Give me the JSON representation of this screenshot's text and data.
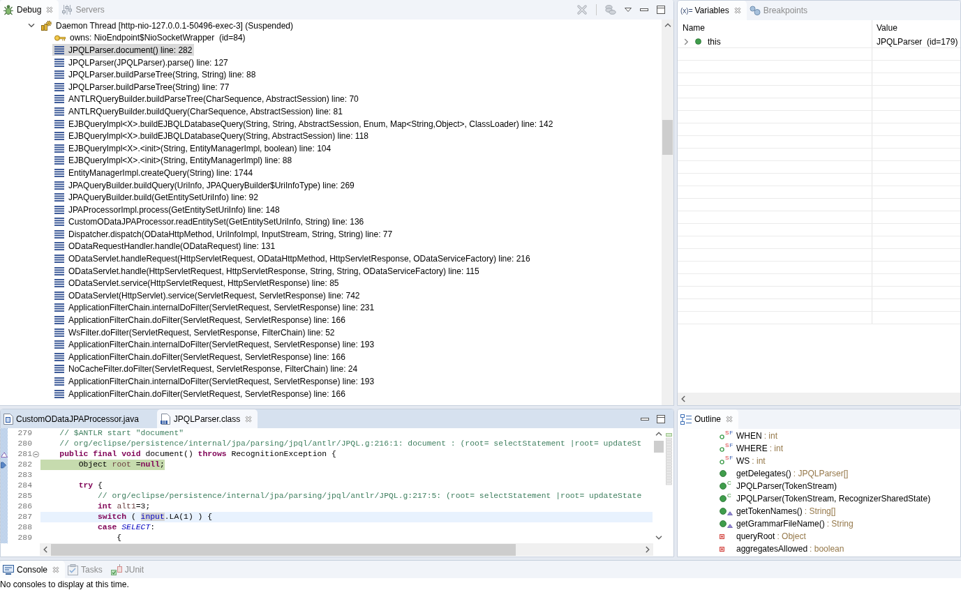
{
  "debug_view": {
    "tabs": [
      {
        "kind": "debug",
        "label": "Debug",
        "selected": true
      },
      {
        "kind": "servers",
        "label": "Servers",
        "selected": false
      }
    ],
    "thread": {
      "label": "Daemon Thread [http-nio-127.0.0.1-50496-exec-3] (Suspended)",
      "expanded": true,
      "monitor": "owns: NioEndpoint$NioSocketWrapper  (id=84)",
      "frames": [
        {
          "label": "JPQLParser.document() line: 282",
          "selected": true
        },
        {
          "label": "JPQLParser(JPQLParser).parse() line: 127",
          "selected": false
        },
        {
          "label": "JPQLParser.buildParseTree(String, String) line: 88",
          "selected": false
        },
        {
          "label": "JPQLParser.buildParseTree(String) line: 77",
          "selected": false
        },
        {
          "label": "ANTLRQueryBuilder.buildParseTree(CharSequence, AbstractSession) line: 70",
          "selected": false
        },
        {
          "label": "ANTLRQueryBuilder.buildQuery(CharSequence, AbstractSession) line: 81",
          "selected": false
        },
        {
          "label": "EJBQueryImpl<X>.buildEJBQLDatabaseQuery(String, String, AbstractSession, Enum, Map<String,Object>, ClassLoader) line: 142",
          "selected": false
        },
        {
          "label": "EJBQueryImpl<X>.buildEJBQLDatabaseQuery(String, AbstractSession) line: 118",
          "selected": false
        },
        {
          "label": "EJBQueryImpl<X>.<init>(String, EntityManagerImpl, boolean) line: 104",
          "selected": false
        },
        {
          "label": "EJBQueryImpl<X>.<init>(String, EntityManagerImpl) line: 88",
          "selected": false
        },
        {
          "label": "EntityManagerImpl.createQuery(String) line: 1744",
          "selected": false
        },
        {
          "label": "JPAQueryBuilder.buildQuery(UriInfo, JPAQueryBuilder$UriInfoType) line: 269",
          "selected": false
        },
        {
          "label": "JPAQueryBuilder.build(GetEntitySetUriInfo) line: 92",
          "selected": false
        },
        {
          "label": "JPAProcessorImpl.process(GetEntitySetUriInfo) line: 148",
          "selected": false
        },
        {
          "label": "CustomODataJPAProcessor.readEntitySet(GetEntitySetUriInfo, String) line: 136",
          "selected": false
        },
        {
          "label": "Dispatcher.dispatch(ODataHttpMethod, UriInfoImpl, InputStream, String, String) line: 77",
          "selected": false
        },
        {
          "label": "ODataRequestHandler.handle(ODataRequest) line: 131",
          "selected": false
        },
        {
          "label": "ODataServlet.handleRequest(HttpServletRequest, ODataHttpMethod, HttpServletResponse, ODataServiceFactory) line: 216",
          "selected": false
        },
        {
          "label": "ODataServlet.handle(HttpServletRequest, HttpServletResponse, String, String, ODataServiceFactory) line: 115",
          "selected": false
        },
        {
          "label": "ODataServlet.service(HttpServletRequest, HttpServletResponse) line: 85",
          "selected": false
        },
        {
          "label": "ODataServlet(HttpServlet).service(ServletRequest, ServletResponse) line: 742",
          "selected": false
        },
        {
          "label": "ApplicationFilterChain.internalDoFilter(ServletRequest, ServletResponse) line: 231",
          "selected": false
        },
        {
          "label": "ApplicationFilterChain.doFilter(ServletRequest, ServletResponse) line: 166",
          "selected": false
        },
        {
          "label": "WsFilter.doFilter(ServletRequest, ServletResponse, FilterChain) line: 52",
          "selected": false
        },
        {
          "label": "ApplicationFilterChain.internalDoFilter(ServletRequest, ServletResponse) line: 193",
          "selected": false
        },
        {
          "label": "ApplicationFilterChain.doFilter(ServletRequest, ServletResponse) line: 166",
          "selected": false
        },
        {
          "label": "NoCacheFilter.doFilter(ServletRequest, ServletResponse, FilterChain) line: 24",
          "selected": false
        },
        {
          "label": "ApplicationFilterChain.internalDoFilter(ServletRequest, ServletResponse) line: 193",
          "selected": false
        },
        {
          "label": "ApplicationFilterChain.doFilter(ServletRequest, ServletResponse) line: 166",
          "selected": false
        }
      ]
    }
  },
  "variables_view": {
    "tabs": [
      {
        "kind": "variables",
        "icon_text": "(x)=",
        "label": "Variables",
        "selected": true
      },
      {
        "kind": "breakpoints",
        "label": "Breakpoints",
        "selected": false
      }
    ],
    "columns": [
      "Name",
      "Value"
    ],
    "rows": [
      {
        "name": "this",
        "value": "JPQLParser  (id=179)",
        "expanded": false
      }
    ]
  },
  "editor": {
    "tabs": [
      {
        "kind": "java",
        "label": "CustomODataJPAProcessor.java",
        "selected": false
      },
      {
        "kind": "class",
        "label": "JPQLParser.class",
        "selected": true
      }
    ],
    "lines": [
      {
        "number": "279",
        "tokens": [
          {
            "kind": "comment",
            "text": "    // $ANTLR start \"document\""
          }
        ],
        "highlighted": false,
        "cursor": false
      },
      {
        "number": "280",
        "tokens": [
          {
            "kind": "comment",
            "text": "    // org/eclipse/persistence/internal/jpa/parsing/jpql/antlr/JPQL.g:216:1: document : (root= selectStatement |root= updateSt"
          }
        ],
        "highlighted": false,
        "cursor": false
      },
      {
        "number": "281",
        "ruler_marker": {
          "kind": "override"
        },
        "fold_expanded": true,
        "tokens": [
          {
            "kind": "keyword",
            "text": "    public final void"
          },
          {
            "kind": "plain",
            "text": " document() "
          },
          {
            "kind": "keyword",
            "text": "throws"
          },
          {
            "kind": "plain",
            "text": " RecognitionException {"
          }
        ],
        "highlighted": false,
        "cursor": false
      },
      {
        "number": "282",
        "ruler_marker": {
          "kind": "instruction-pointer"
        },
        "tokens": [
          {
            "kind": "plain",
            "text": "        Object "
          },
          {
            "kind": "local",
            "text": "root"
          },
          {
            "kind": "plain",
            "text": " ="
          },
          {
            "kind": "keyword",
            "text": "null"
          },
          {
            "kind": "plain",
            "text": ";"
          }
        ],
        "highlighted": true,
        "cursor": false
      },
      {
        "number": "283",
        "cursor": false
      },
      {
        "number": "284",
        "tokens": [
          {
            "kind": "keyword",
            "text": "        try"
          },
          {
            "kind": "plain",
            "text": " {"
          }
        ],
        "highlighted": false,
        "cursor": false
      },
      {
        "number": "285",
        "tokens": [
          {
            "kind": "comment",
            "text": "            // org/eclipse/persistence/internal/jpa/parsing/jpql/antlr/JPQL.g:217:5: (root= selectStatement |root= updateState"
          }
        ],
        "highlighted": false,
        "cursor": false
      },
      {
        "number": "286",
        "tokens": [
          {
            "kind": "keyword",
            "text": "            int "
          },
          {
            "kind": "local",
            "text": "alt1"
          },
          {
            "kind": "plain",
            "text": "=3;"
          }
        ],
        "highlighted": false,
        "cursor": false
      },
      {
        "number": "287",
        "tokens": [
          {
            "kind": "keyword",
            "text": "            switch"
          },
          {
            "kind": "plain",
            "text": " ( "
          },
          {
            "kind": "field-occurrence",
            "text": "input"
          },
          {
            "kind": "plain",
            "text": ".LA(1) ) {"
          }
        ],
        "highlighted": false,
        "cursor": true
      },
      {
        "number": "288",
        "tokens": [
          {
            "kind": "keyword",
            "text": "            case "
          },
          {
            "kind": "static-field",
            "text": "SELECT"
          },
          {
            "kind": "plain",
            "text": ":"
          }
        ],
        "highlighted": false,
        "cursor": false
      },
      {
        "number": "289",
        "tokens": [
          {
            "kind": "plain",
            "text": "                {"
          }
        ],
        "highlighted": false,
        "cursor": false
      }
    ]
  },
  "outline_view": {
    "tabs": [
      {
        "kind": "outline",
        "label": "Outline",
        "selected": true
      }
    ],
    "items": [
      {
        "kind": "constant",
        "modifiers": [
          {
            "kind": "static",
            "text": "S"
          },
          {
            "kind": "final",
            "text": "F"
          }
        ],
        "overrides": false,
        "name": "WHEN",
        "type": ": int"
      },
      {
        "kind": "constant",
        "modifiers": [
          {
            "kind": "static",
            "text": "S"
          },
          {
            "kind": "final",
            "text": "F"
          }
        ],
        "overrides": false,
        "name": "WHERE",
        "type": ": int"
      },
      {
        "kind": "constant",
        "modifiers": [
          {
            "kind": "static",
            "text": "S"
          },
          {
            "kind": "final",
            "text": "F"
          }
        ],
        "overrides": false,
        "name": "WS",
        "type": ": int"
      },
      {
        "kind": "method",
        "overrides": false,
        "name": "getDelegates()",
        "type": ": JPQLParser[]"
      },
      {
        "kind": "method",
        "modifiers": [
          {
            "kind": "constructor",
            "text": "C"
          }
        ],
        "overrides": false,
        "name": "JPQLParser(TokenStream)"
      },
      {
        "kind": "method",
        "modifiers": [
          {
            "kind": "constructor",
            "text": "C"
          }
        ],
        "overrides": false,
        "name": "JPQLParser(TokenStream, RecognizerSharedState)"
      },
      {
        "kind": "method",
        "overrides": true,
        "name": "getTokenNames()",
        "type": ": String[]"
      },
      {
        "kind": "method",
        "overrides": true,
        "name": "getGrammarFileName()",
        "type": ": String"
      },
      {
        "kind": "private-field",
        "overrides": false,
        "name": "queryRoot",
        "type": ": Object"
      },
      {
        "kind": "private-field",
        "overrides": false,
        "name": "aggregatesAllowed",
        "type": ": boolean"
      }
    ]
  },
  "console_view": {
    "tabs": [
      {
        "kind": "console",
        "label": "Console",
        "selected": true
      },
      {
        "kind": "tasks",
        "label": "Tasks",
        "selected": false
      },
      {
        "kind": "junit",
        "label": "JUnit",
        "selected": false
      }
    ],
    "message": "No consoles to display at this time."
  }
}
